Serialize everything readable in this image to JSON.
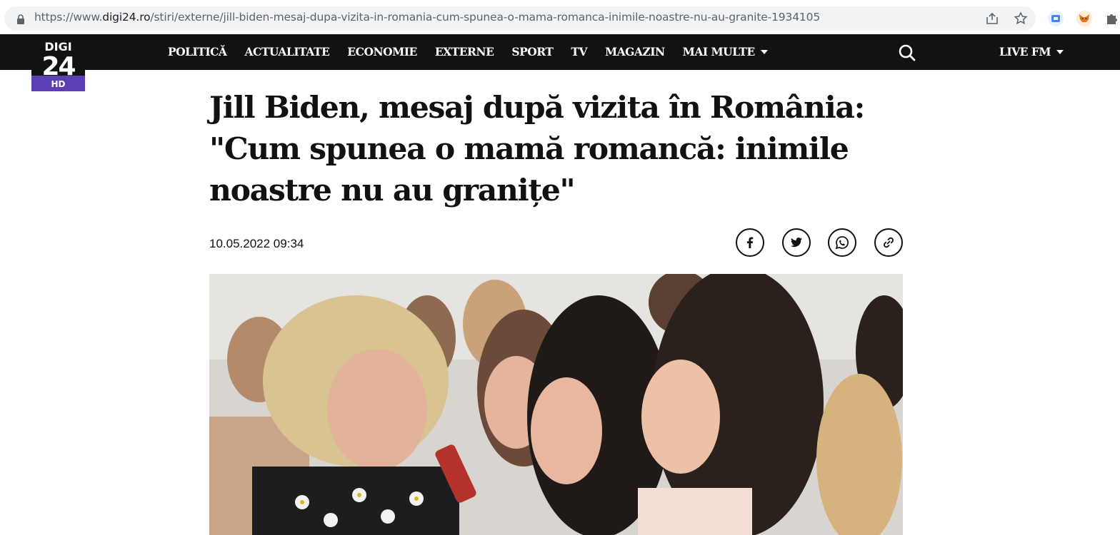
{
  "browser": {
    "url_prefix": "https://www.",
    "url_domain": "digi24.ro",
    "url_path": "/stiri/externe/jill-biden-mesaj-dupa-vizita-in-romania-cum-spunea-o-mama-romanca-inimile-noastre-nu-au-granite-1934105"
  },
  "logo": {
    "line1": "DIGI",
    "line2": "24",
    "badge": "HD"
  },
  "nav": {
    "items": [
      "POLITICĂ",
      "ACTUALITATE",
      "ECONOMIE",
      "EXTERNE",
      "SPORT",
      "TV",
      "MAGAZIN"
    ],
    "more_label": "MAI MULTE",
    "live_label": "LIVE FM"
  },
  "article": {
    "title": "Jill Biden, mesaj după vizita în România: \"Cum spunea o mamă romancă: inimile noastre nu au granițe\"",
    "date": "10.05.2022 09:34"
  },
  "share_icons": [
    "facebook-icon",
    "twitter-icon",
    "whatsapp-icon",
    "link-icon"
  ],
  "colors": {
    "header_bg": "#111214",
    "hd_badge": "#5b3fb5",
    "text": "#111111"
  }
}
